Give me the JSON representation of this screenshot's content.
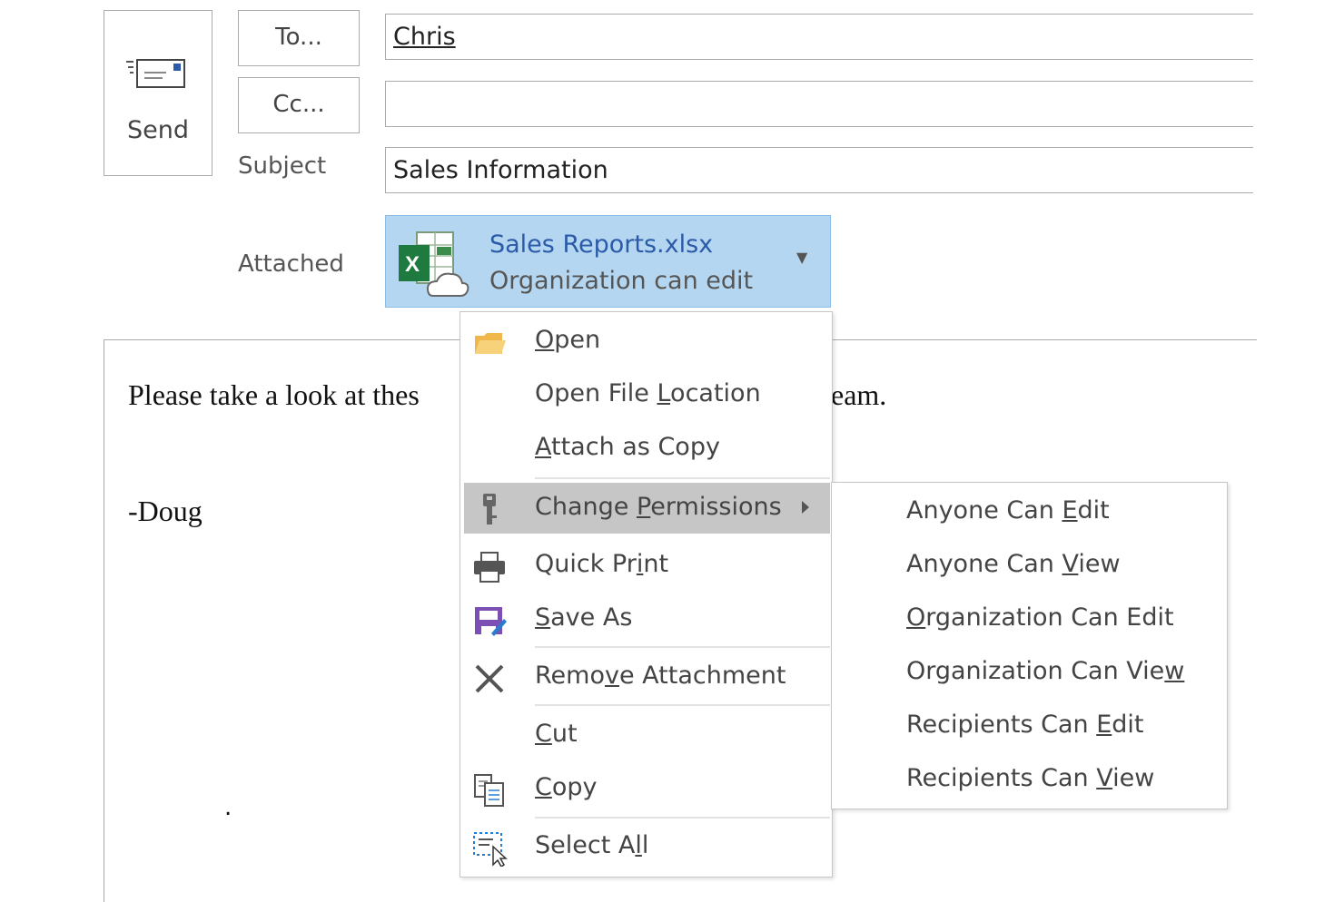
{
  "header": {
    "send_label": "Send",
    "to_button": "To...",
    "cc_button": "Cc...",
    "to_value": "Chris",
    "cc_value": "",
    "subject_label": "Subject",
    "subject_value": "Sales Information",
    "attached_label": "Attached"
  },
  "attachment": {
    "file_name": "Sales Reports.xlsx",
    "permission": "Organization can edit",
    "icon": "excel-cloud-icon"
  },
  "body": {
    "line1_start": "Please take a look at thes",
    "line1_end": "eam.",
    "signature": "-Doug",
    "stray_dot": "."
  },
  "context_menu": {
    "items": [
      {
        "pre": "",
        "u": "O",
        "post": "pen",
        "icon": "folder-icon"
      },
      {
        "pre": "Open File ",
        "u": "L",
        "post": "ocation",
        "icon": ""
      },
      {
        "pre": "",
        "u": "A",
        "post": "ttach as Copy",
        "icon": ""
      },
      {
        "pre": "Change ",
        "u": "P",
        "post": "ermissions",
        "icon": "key-icon",
        "highlighted": true
      },
      {
        "pre": "Quick Pr",
        "u": "i",
        "post": "nt",
        "icon": "printer-icon"
      },
      {
        "pre": "",
        "u": "S",
        "post": "ave As",
        "icon": "save-as-icon"
      },
      {
        "pre": "Remo",
        "u": "v",
        "post": "e Attachment",
        "icon": "close-x-icon"
      },
      {
        "pre": "",
        "u": "C",
        "post": "ut",
        "icon": ""
      },
      {
        "pre": "",
        "u": "C",
        "post": "opy",
        "icon": "copy-icon"
      },
      {
        "pre": "Select A",
        "u": "l",
        "post": "l",
        "icon": "select-all-icon"
      }
    ]
  },
  "submenu": {
    "items": [
      {
        "pre": "Anyone Can ",
        "u": "E",
        "post": "dit"
      },
      {
        "pre": "Anyone Can ",
        "u": "V",
        "post": "iew"
      },
      {
        "pre": "",
        "u": "O",
        "post": "rganization Can Edit"
      },
      {
        "pre": "Organization Can Vie",
        "u": "w",
        "post": ""
      },
      {
        "pre": "Recipients Can ",
        "u": "E",
        "post": "dit"
      },
      {
        "pre": "Recipients Can ",
        "u": "V",
        "post": "iew"
      }
    ]
  },
  "colors": {
    "attachment_bg": "#b4d6f0",
    "attachment_name": "#2a5aa8",
    "menu_highlight": "#c6c6c6"
  }
}
